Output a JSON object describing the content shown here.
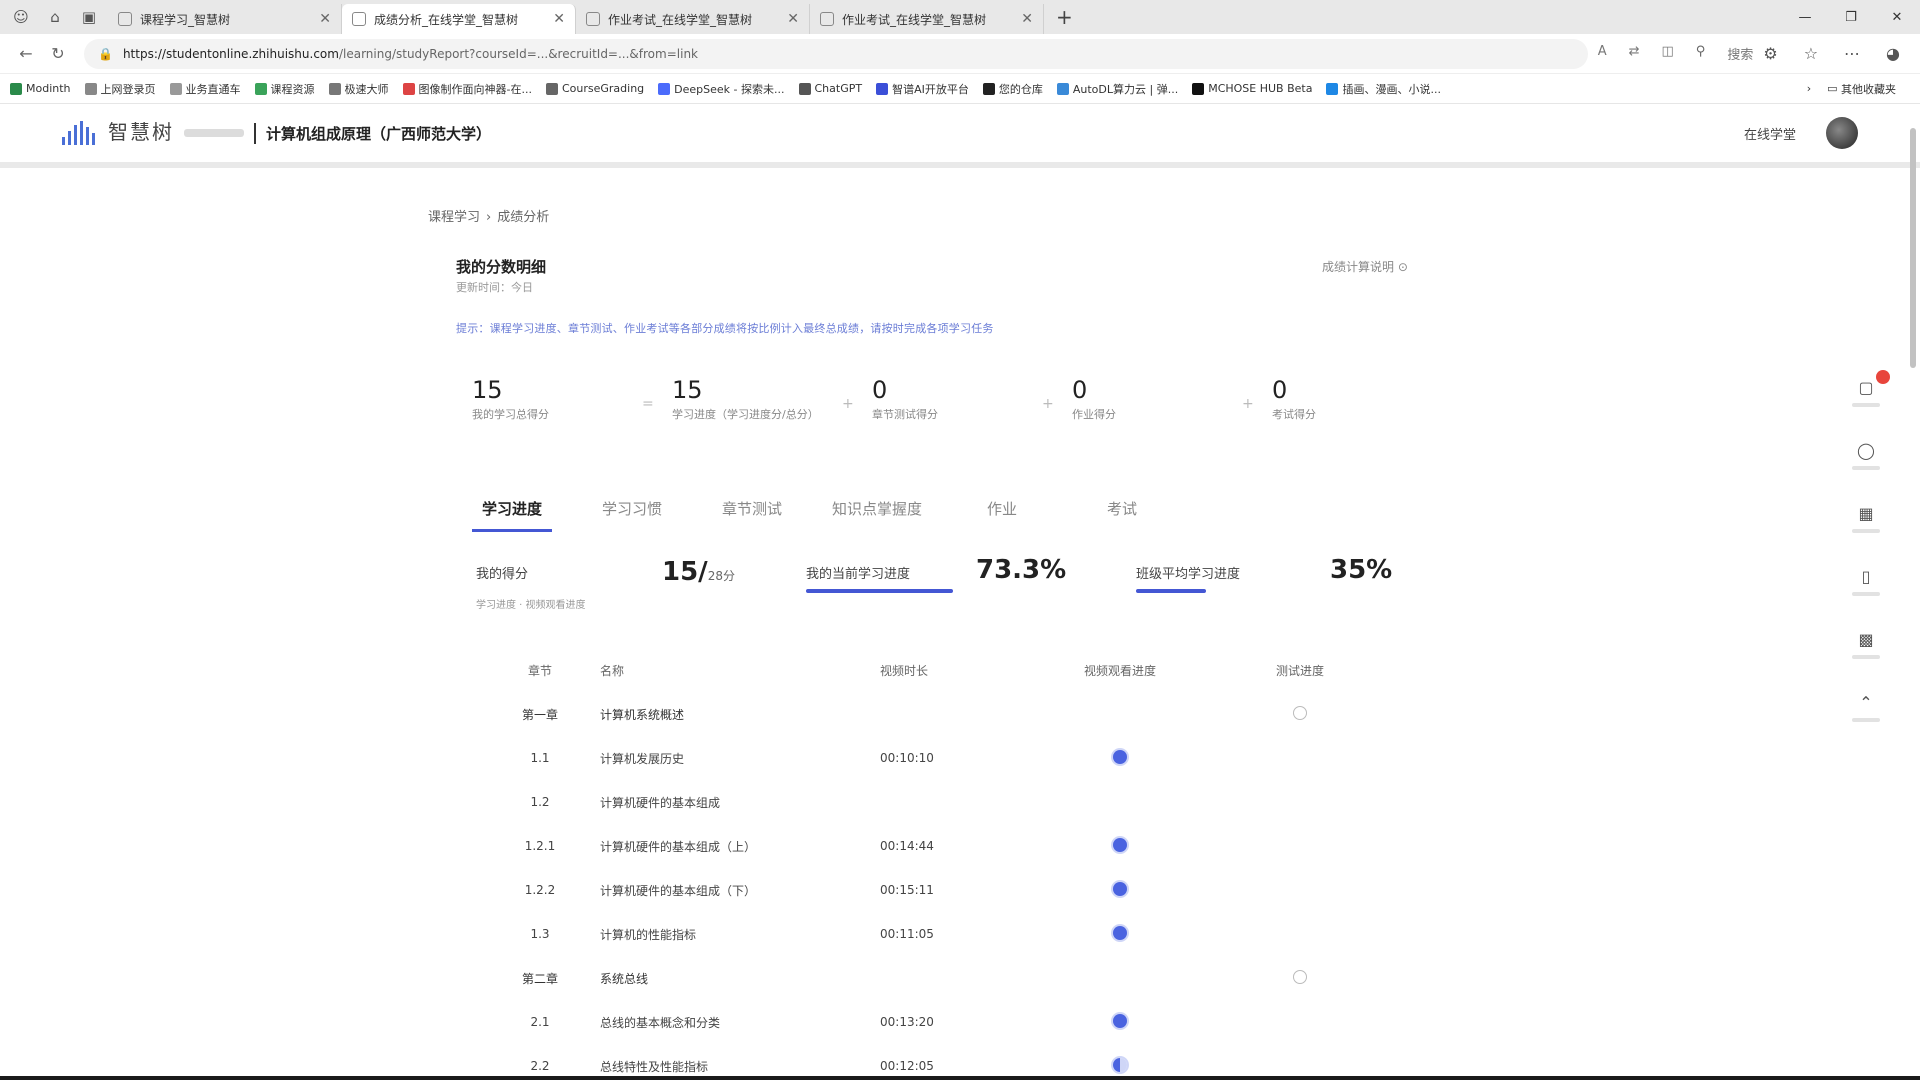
{
  "browser": {
    "tabs": [
      {
        "title": "课程学习_智慧树",
        "active": false
      },
      {
        "title": "成绩分析_在线学堂_智慧树",
        "active": true
      },
      {
        "title": "作业考试_在线学堂_智慧树",
        "active": false
      },
      {
        "title": "作业考试_在线学堂_智慧树",
        "active": false
      }
    ],
    "url": {
      "host": "https://studentonline.zhihuishu.com",
      "rest": "/learning/studyReport?courseId=...&recruitId=...&from=link"
    },
    "search_label": "搜索",
    "bookmarks": [
      "Modinth",
      "上网登录页",
      "业务直通车",
      "课程资源",
      "极速大师",
      "图像制作面向神器-在...",
      "CourseGrading",
      "DeepSeek - 探索未...",
      "ChatGPT",
      "智谱AI开放平台",
      "您的仓库",
      "AutoDL算力云 | 弹...",
      "MCHOSE HUB Beta",
      "插画、漫画、小说..."
    ],
    "bookmarks_other": "其他收藏夹"
  },
  "site": {
    "logo_text": "智慧树",
    "course_title": "计算机组成原理（广西师范大学）",
    "online_label": "在线学堂"
  },
  "breadcrumb": {
    "parent": "课程学习",
    "current": "成绩分析"
  },
  "section": {
    "title": "我的分数明细",
    "subtitle": "更新时间：今日",
    "right_text": "成绩计算说明",
    "notice": "提示：课程学习进度、章节测试、作业考试等各部分成绩将按比例计入最终总成绩，请按时完成各项学习任务"
  },
  "stats": [
    {
      "value": "15",
      "label": "我的学习总得分"
    },
    {
      "value": "15",
      "label": "学习进度（学习进度分/总分）"
    },
    {
      "value": "0",
      "label": "章节测试得分"
    },
    {
      "value": "0",
      "label": "作业得分"
    },
    {
      "value": "0",
      "label": "考试得分"
    }
  ],
  "tabs": [
    "学习进度",
    "学习习惯",
    "章节测试",
    "知识点掌握度",
    "作业",
    "考试"
  ],
  "summary": {
    "score_label": "我的得分",
    "score_sub": "学习进度 · 视频观看进度",
    "score_value": "15/",
    "score_total": "28分",
    "progress_label": "我的当前学习进度",
    "progress_value": "73.3%",
    "progress_fraction": 0.733,
    "avg_label": "班级平均学习进度",
    "avg_value": "35%",
    "avg_fraction": 0.35
  },
  "table": {
    "headers": [
      "章节",
      "名称",
      "视频时长",
      "视频观看进度",
      "测试进度"
    ],
    "rows": [
      {
        "kind": "chapter",
        "num": "第一章",
        "name": "计算机系统概述",
        "duration": "",
        "status": "",
        "test": "ring"
      },
      {
        "kind": "item",
        "num": "1.1",
        "name": "计算机发展历史",
        "duration": "00:10:10",
        "status": "done",
        "test": ""
      },
      {
        "kind": "item",
        "num": "1.2",
        "name": "计算机硬件的基本组成",
        "duration": "",
        "status": "",
        "test": ""
      },
      {
        "kind": "item",
        "num": "1.2.1",
        "name": "计算机硬件的基本组成（上）",
        "duration": "00:14:44",
        "status": "done",
        "test": ""
      },
      {
        "kind": "item",
        "num": "1.2.2",
        "name": "计算机硬件的基本组成（下）",
        "duration": "00:15:11",
        "status": "done",
        "test": ""
      },
      {
        "kind": "item",
        "num": "1.3",
        "name": "计算机的性能指标",
        "duration": "00:11:05",
        "status": "done",
        "test": ""
      },
      {
        "kind": "chapter",
        "num": "第二章",
        "name": "系统总线",
        "duration": "",
        "status": "",
        "test": "ring"
      },
      {
        "kind": "item",
        "num": "2.1",
        "name": "总线的基本概念和分类",
        "duration": "00:13:20",
        "status": "done",
        "test": ""
      },
      {
        "kind": "item",
        "num": "2.2",
        "name": "总线特性及性能指标",
        "duration": "00:12:05",
        "status": "half",
        "test": ""
      }
    ]
  },
  "colors": {
    "accent": "#4457d4",
    "badge": "#e8453c"
  }
}
